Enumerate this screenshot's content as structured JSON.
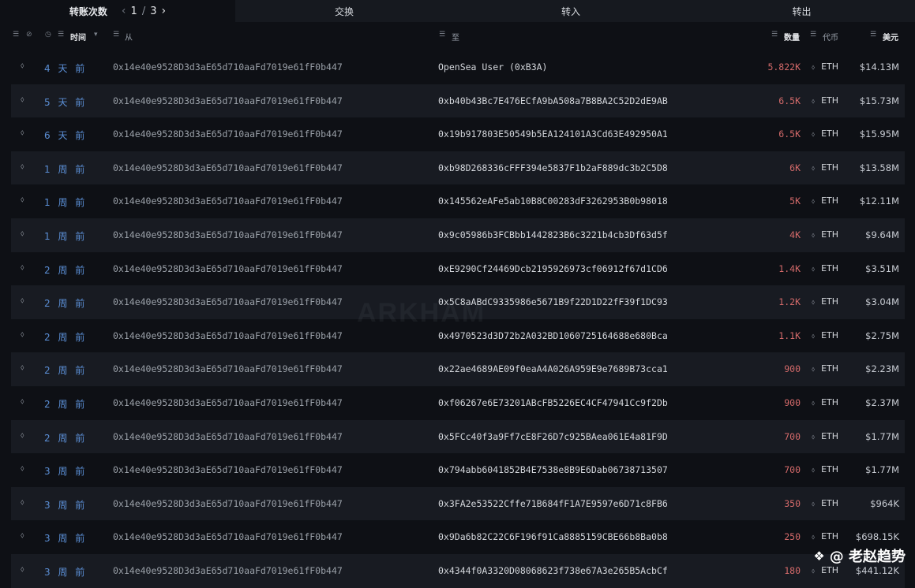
{
  "tabs": {
    "transfers_label": "转账次数",
    "page_current": "1",
    "page_sep": "/",
    "page_total": "3",
    "swap_label": "交换",
    "in_label": "转入",
    "out_label": "转出"
  },
  "headers": {
    "time": "时间",
    "from": "从",
    "to": "至",
    "amount": "数量",
    "token": "代币",
    "usd": "美元"
  },
  "watermark": "ARKHAM",
  "brand": "@ 老赵趋势",
  "rows": [
    {
      "time": "4 天 前",
      "from": "0x14e40e9528D3d3aE65d710aaFd7019e61fF0b447",
      "to": "OpenSea User (0xB3A)",
      "amount": "5.822K",
      "token": "ETH",
      "usd": "$14.13M"
    },
    {
      "time": "5 天 前",
      "from": "0x14e40e9528D3d3aE65d710aaFd7019e61fF0b447",
      "to": "0xb40b43Bc7E476ECfA9bA508a7B8BA2C52D2dE9AB",
      "amount": "6.5K",
      "token": "ETH",
      "usd": "$15.73M"
    },
    {
      "time": "6 天 前",
      "from": "0x14e40e9528D3d3aE65d710aaFd7019e61fF0b447",
      "to": "0x19b917803E50549b5EA124101A3Cd63E492950A1",
      "amount": "6.5K",
      "token": "ETH",
      "usd": "$15.95M"
    },
    {
      "time": "1 周 前",
      "from": "0x14e40e9528D3d3aE65d710aaFd7019e61fF0b447",
      "to": "0xb98D268336cFFF394e5837F1b2aF889dc3b2C5D8",
      "amount": "6K",
      "token": "ETH",
      "usd": "$13.58M"
    },
    {
      "time": "1 周 前",
      "from": "0x14e40e9528D3d3aE65d710aaFd7019e61fF0b447",
      "to": "0x145562eAFe5ab10B8C00283dF3262953B0b98018",
      "amount": "5K",
      "token": "ETH",
      "usd": "$12.11M"
    },
    {
      "time": "1 周 前",
      "from": "0x14e40e9528D3d3aE65d710aaFd7019e61fF0b447",
      "to": "0x9c05986b3FCBbb1442823B6c3221b4cb3Df63d5f",
      "amount": "4K",
      "token": "ETH",
      "usd": "$9.64M"
    },
    {
      "time": "2 周 前",
      "from": "0x14e40e9528D3d3aE65d710aaFd7019e61fF0b447",
      "to": "0xE9290Cf24469Dcb2195926973cf06912f67d1CD6",
      "amount": "1.4K",
      "token": "ETH",
      "usd": "$3.51M"
    },
    {
      "time": "2 周 前",
      "from": "0x14e40e9528D3d3aE65d710aaFd7019e61fF0b447",
      "to": "0x5C8aABdC9335986e5671B9f22D1D22fF39f1DC93",
      "amount": "1.2K",
      "token": "ETH",
      "usd": "$3.04M"
    },
    {
      "time": "2 周 前",
      "from": "0x14e40e9528D3d3aE65d710aaFd7019e61fF0b447",
      "to": "0x4970523d3D72b2A032BD1060725164688e680Bca",
      "amount": "1.1K",
      "token": "ETH",
      "usd": "$2.75M"
    },
    {
      "time": "2 周 前",
      "from": "0x14e40e9528D3d3aE65d710aaFd7019e61fF0b447",
      "to": "0x22ae4689AE09f0eaA4A026A959E9e7689B73cca1",
      "amount": "900",
      "token": "ETH",
      "usd": "$2.23M"
    },
    {
      "time": "2 周 前",
      "from": "0x14e40e9528D3d3aE65d710aaFd7019e61fF0b447",
      "to": "0xf06267e6E73201ABcFB5226EC4CF47941Cc9f2Db",
      "amount": "900",
      "token": "ETH",
      "usd": "$2.37M"
    },
    {
      "time": "2 周 前",
      "from": "0x14e40e9528D3d3aE65d710aaFd7019e61fF0b447",
      "to": "0x5FCc40f3a9Ff7cE8F26D7c925BAea061E4a81F9D",
      "amount": "700",
      "token": "ETH",
      "usd": "$1.77M"
    },
    {
      "time": "3 周 前",
      "from": "0x14e40e9528D3d3aE65d710aaFd7019e61fF0b447",
      "to": "0x794abb6041852B4E7538e8B9E6Dab06738713507",
      "amount": "700",
      "token": "ETH",
      "usd": "$1.77M"
    },
    {
      "time": "3 周 前",
      "from": "0x14e40e9528D3d3aE65d710aaFd7019e61fF0b447",
      "to": "0x3FA2e53522Cffe71B684fF1A7E9597e6D71c8FB6",
      "amount": "350",
      "token": "ETH",
      "usd": "$964K"
    },
    {
      "time": "3 周 前",
      "from": "0x14e40e9528D3d3aE65d710aaFd7019e61fF0b447",
      "to": "0x9Da6b82C22C6F196f91Ca8885159CBE66b8Ba0b8",
      "amount": "250",
      "token": "ETH",
      "usd": "$698.15K"
    },
    {
      "time": "3 周 前",
      "from": "0x14e40e9528D3d3aE65d710aaFd7019e61fF0b447",
      "to": "0x4344f0A3320D08068623f738e67A3e265B5AcbCf",
      "amount": "180",
      "token": "ETH",
      "usd": "$441.12K"
    }
  ]
}
